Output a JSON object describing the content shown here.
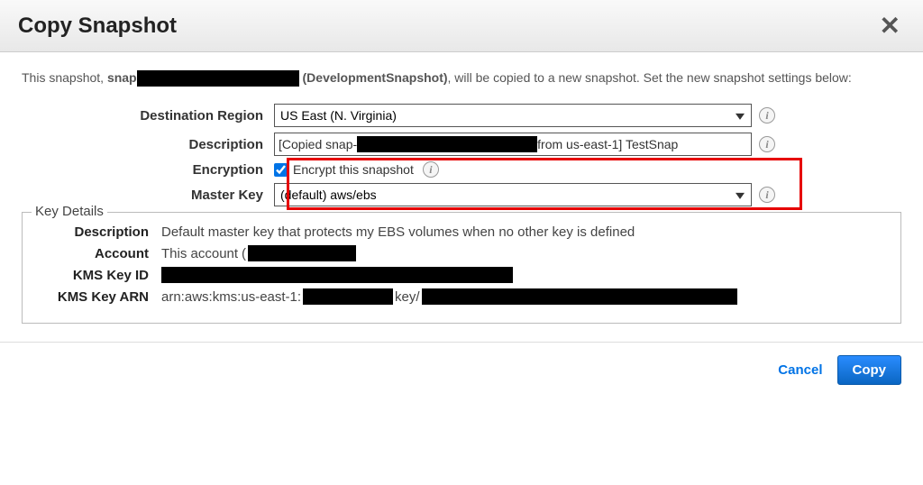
{
  "header": {
    "title": "Copy Snapshot"
  },
  "intro": {
    "prefix": "This snapshot, ",
    "snap_prefix": "snap",
    "name_paren": "(DevelopmentSnapshot)",
    "suffix": ", will be copied to a new snapshot. Set the new snapshot settings below:"
  },
  "form": {
    "destination_region": {
      "label": "Destination Region",
      "value": "US East (N. Virginia)"
    },
    "description": {
      "label": "Description",
      "value_prefix": "[Copied snap-",
      "value_mid": "from us-east-1] TestSnap"
    },
    "encryption": {
      "label": "Encryption",
      "checkbox_label": "Encrypt this snapshot",
      "checked": true
    },
    "master_key": {
      "label": "Master Key",
      "value": "(default) aws/ebs"
    }
  },
  "key_details": {
    "legend": "Key Details",
    "description": {
      "label": "Description",
      "value": "Default master key that protects my EBS volumes when no other key is defined"
    },
    "account": {
      "label": "Account",
      "value": "This account"
    },
    "kms_key_id": {
      "label": "KMS Key ID"
    },
    "kms_key_arn": {
      "label": "KMS Key ARN",
      "value_prefix": "arn:aws:kms:us-east-1:",
      "value_mid": "key/"
    }
  },
  "footer": {
    "cancel": "Cancel",
    "copy": "Copy"
  }
}
